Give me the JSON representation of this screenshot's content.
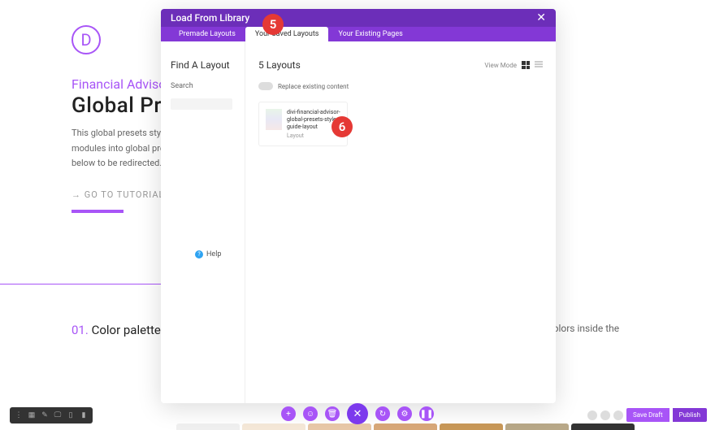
{
  "background_page": {
    "logo_letter": "D",
    "subtitle": "Financial Advisor Layo",
    "title": "Global Prese",
    "description_line1": "This global presets style guide is a",
    "description_line2": "modules into global presets? For a",
    "description_line3": "below to be redirected.",
    "go_tutorial_label": "→ GO TO TUTORIAL",
    "section_number": "01.",
    "section_name": "Color palette",
    "inside_text": "e colors inside the"
  },
  "modal": {
    "title": "Load From Library",
    "tabs": {
      "premade": "Premade Layouts",
      "saved": "Your Saved Layouts",
      "existing": "Your Existing Pages"
    },
    "sidebar": {
      "title": "Find A Layout",
      "search_label": "Search",
      "help_label": "Help"
    },
    "main": {
      "layouts_count": "5 Layouts",
      "view_mode_label": "View Mode",
      "replace_label": "Replace existing content",
      "layout_item": {
        "name": "divi-financial-advisor-global-presets-style-guide-layout",
        "type": "Layout"
      }
    }
  },
  "annotations": {
    "five": "5",
    "six": "6"
  },
  "bottom_actions": {
    "save_draft": "Save Draft",
    "publish": "Publish"
  },
  "color_swatches": [
    "#f0f0f0",
    "#f5e8d8",
    "#e8c8a8",
    "#d8a878",
    "#c89858",
    "#b8a888",
    "#333333"
  ]
}
